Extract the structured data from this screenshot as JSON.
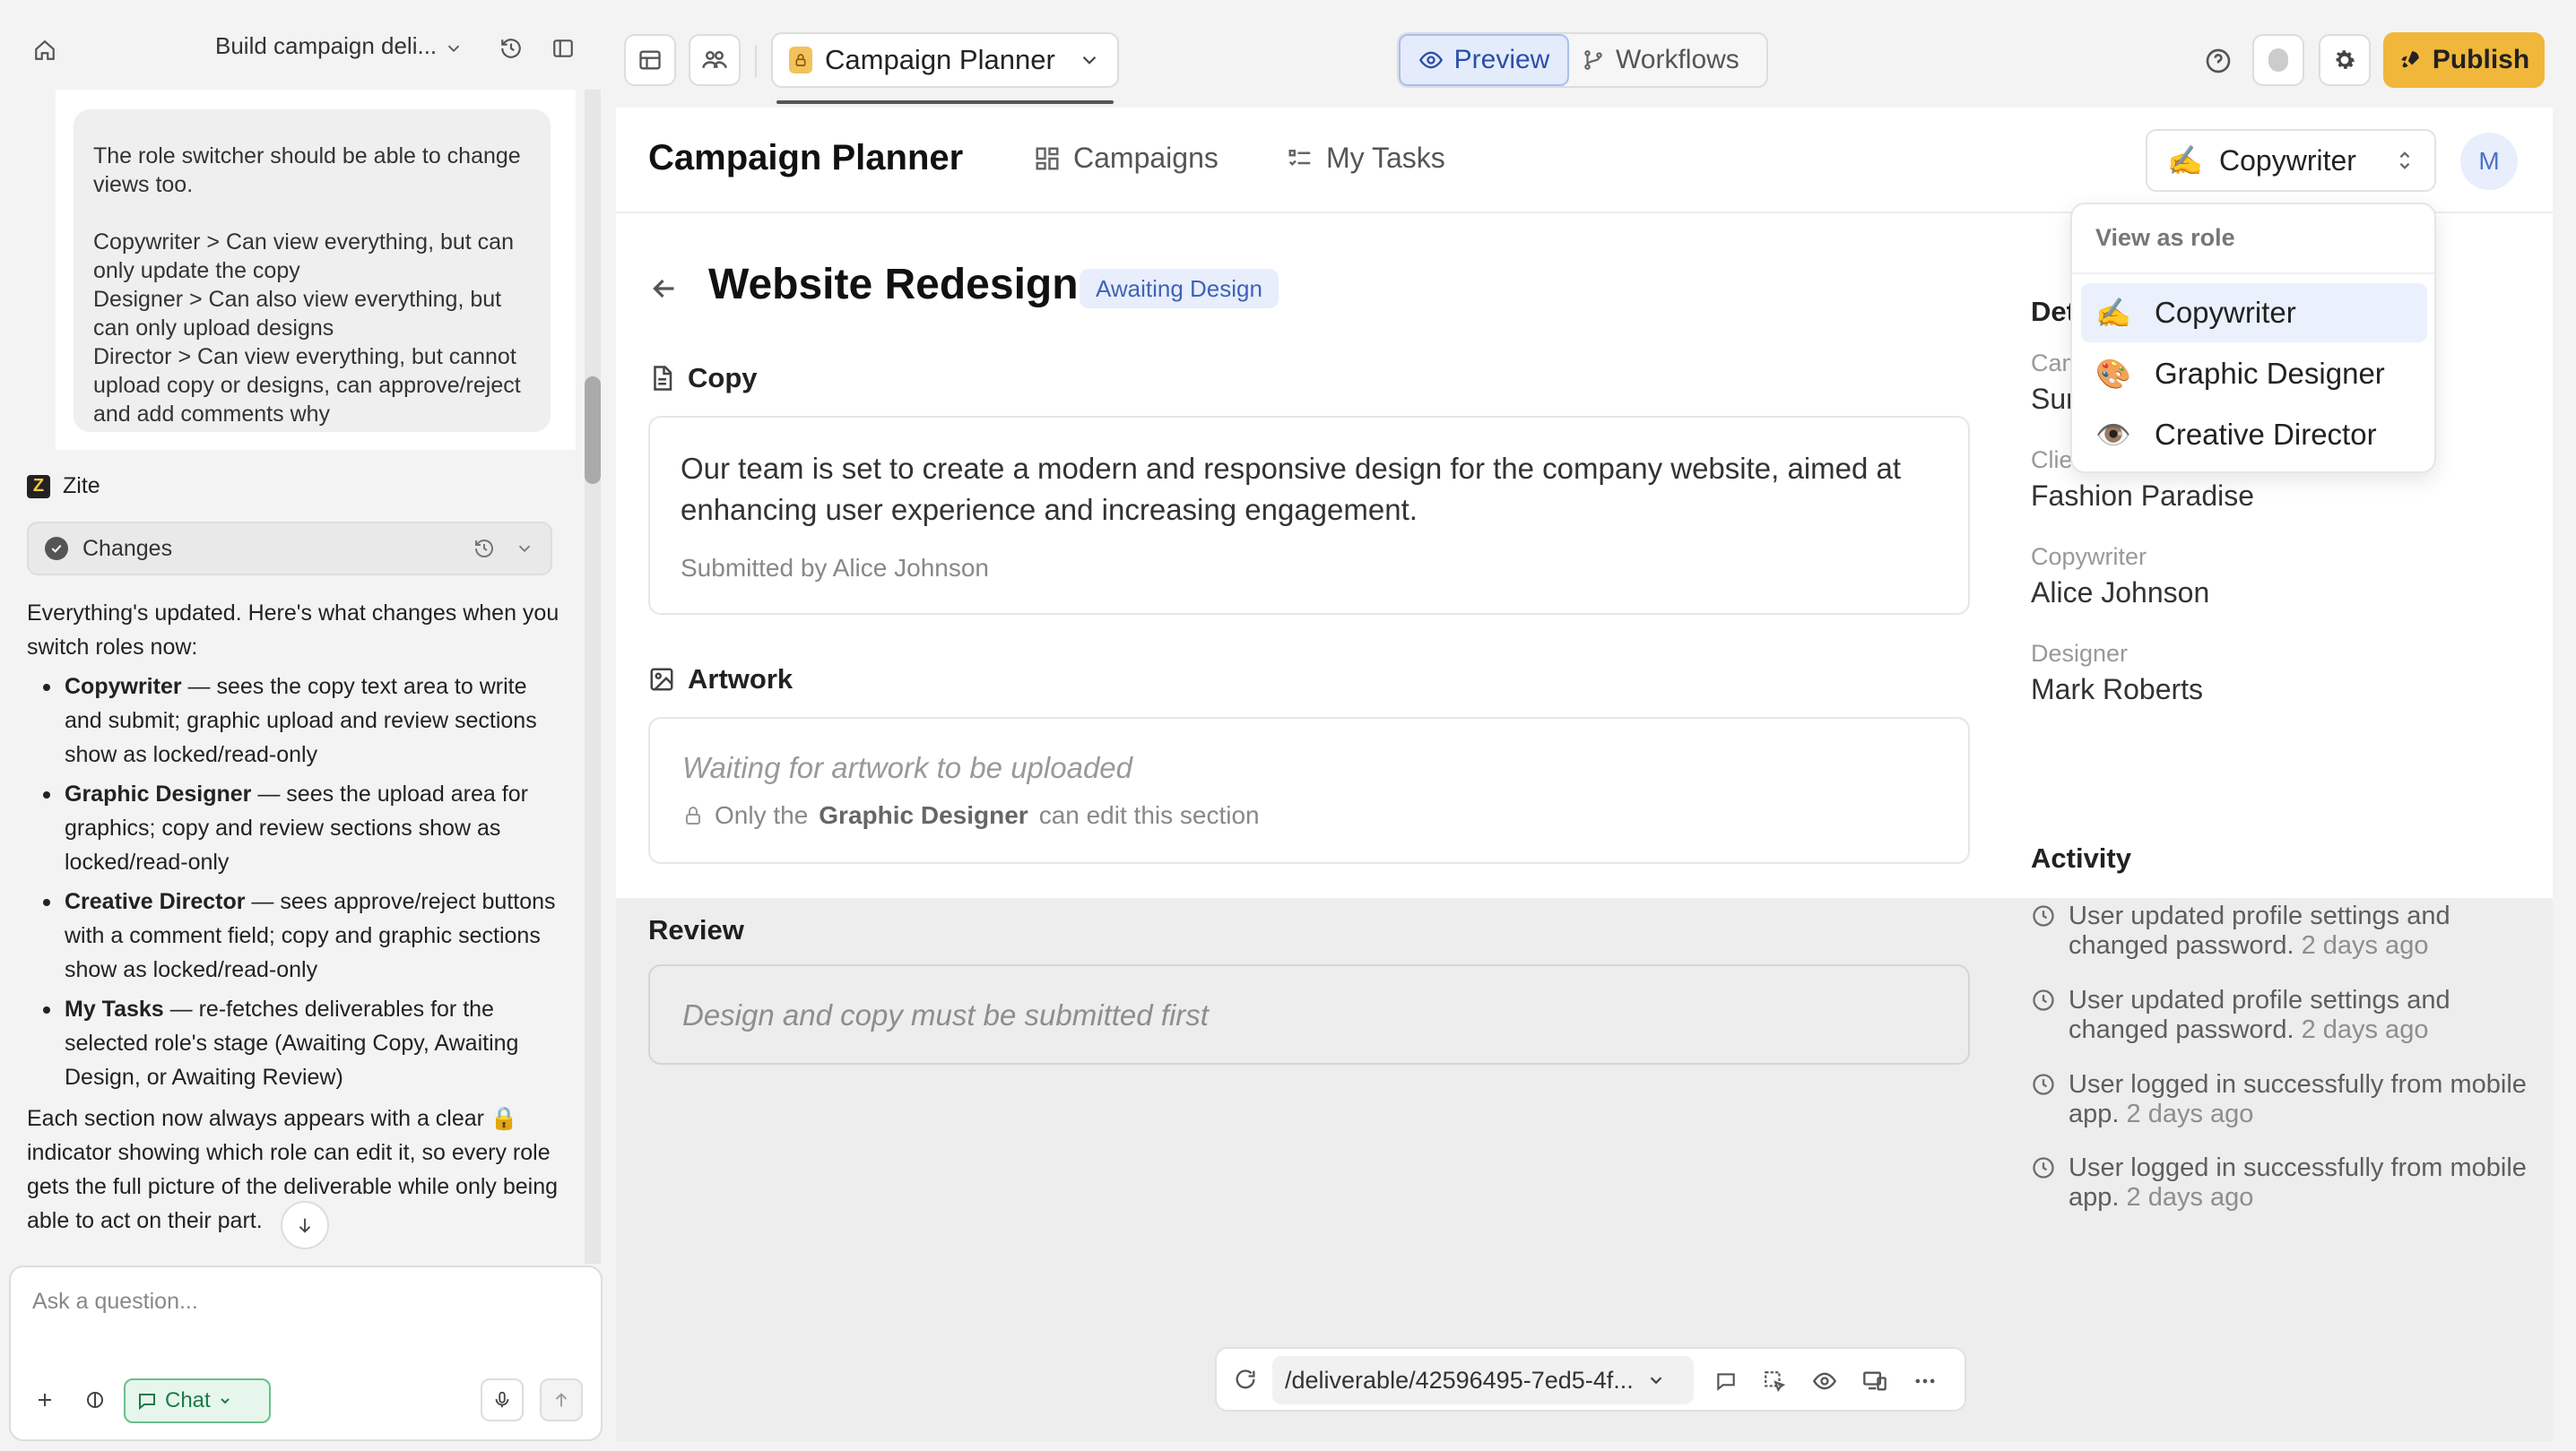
{
  "left_panel": {
    "title": "Build campaign deli...",
    "user_message": "The role switcher should be able to change views too.\n\nCopywriter > Can view everything, but can only update the copy\nDesigner > Can also view everything, but can only upload designs\nDirector > Can view everything, but cannot upload copy or designs, can approve/reject and add comments why",
    "assistant_name": "Zite",
    "changes_label": "Changes",
    "intro": "Everything's updated. Here's what changes when you switch roles now:",
    "bullets": [
      {
        "bold": "Copywriter",
        "text": " — sees the copy text area to write and submit; graphic upload and review sections show as locked/read-only"
      },
      {
        "bold": "Graphic Designer",
        "text": " — sees the upload area for graphics; copy and review sections show as locked/read-only"
      },
      {
        "bold": "Creative Director",
        "text": " — sees approve/reject buttons with a comment field; copy and graphic sections show as locked/read-only"
      },
      {
        "bold": "My Tasks",
        "text": " — re-fetches deliverables for the selected role's stage (Awaiting Copy, Awaiting Design, or Awaiting Review)"
      }
    ],
    "outro": "Each section now always appears with a clear 🔒 indicator showing which role can edit it, so every role gets the full picture of the deliverable while only being able to act on their part.",
    "input_placeholder": "Ask a question...",
    "chat_mode": "Chat"
  },
  "topbar": {
    "app_name": "Campaign Planner",
    "preview_label": "Preview",
    "workflows_label": "Workflows",
    "publish_label": "Publish"
  },
  "app": {
    "title": "Campaign Planner",
    "nav": [
      "Campaigns",
      "My Tasks"
    ],
    "current_role": "Copywriter",
    "avatar_initial": "M",
    "page_title": "Website Redesign",
    "status": "Awaiting Design",
    "copy": {
      "heading": "Copy",
      "text": "Our team is set to create a modern and responsive design for the company website, aimed at enhancing user experience and increasing engagement.",
      "submitted_by": "Submitted by Alice Johnson"
    },
    "artwork": {
      "heading": "Artwork",
      "waiting": "Waiting for artwork to be uploaded",
      "lock_prefix": "Only the",
      "lock_role": "Graphic Designer",
      "lock_suffix": "can edit this section"
    },
    "review": {
      "heading": "Review",
      "waiting": "Design and copy must be submitted first"
    },
    "details": {
      "heading": "Details",
      "fields": [
        {
          "label": "Campaign",
          "value": "Summer Sale Campaign"
        },
        {
          "label": "Client",
          "value": "Fashion Paradise"
        },
        {
          "label": "Copywriter",
          "value": "Alice Johnson"
        },
        {
          "label": "Designer",
          "value": "Mark Roberts"
        }
      ]
    },
    "activity": {
      "heading": "Activity",
      "items": [
        {
          "text": "User updated profile settings and changed password.",
          "time": "2 days ago"
        },
        {
          "text": "User updated profile settings and changed password.",
          "time": "2 days ago"
        },
        {
          "text": "User logged in successfully from mobile app.",
          "time": "2 days ago"
        },
        {
          "text": "User logged in successfully from mobile app.",
          "time": "2 days ago"
        }
      ]
    },
    "role_dropdown": {
      "header": "View as role",
      "options": [
        {
          "emoji": "✍️",
          "label": "Copywriter",
          "selected": true
        },
        {
          "emoji": "🎨",
          "label": "Graphic Designer",
          "selected": false
        },
        {
          "emoji": "👁️",
          "label": "Creative Director",
          "selected": false
        }
      ]
    }
  },
  "urlbar": {
    "path": "/deliverable/42596495-7ed5-4f..."
  },
  "colors": {
    "accent": "#2b4fa5",
    "publish": "#f1b73b",
    "badge_bg": "#e8eefb"
  }
}
